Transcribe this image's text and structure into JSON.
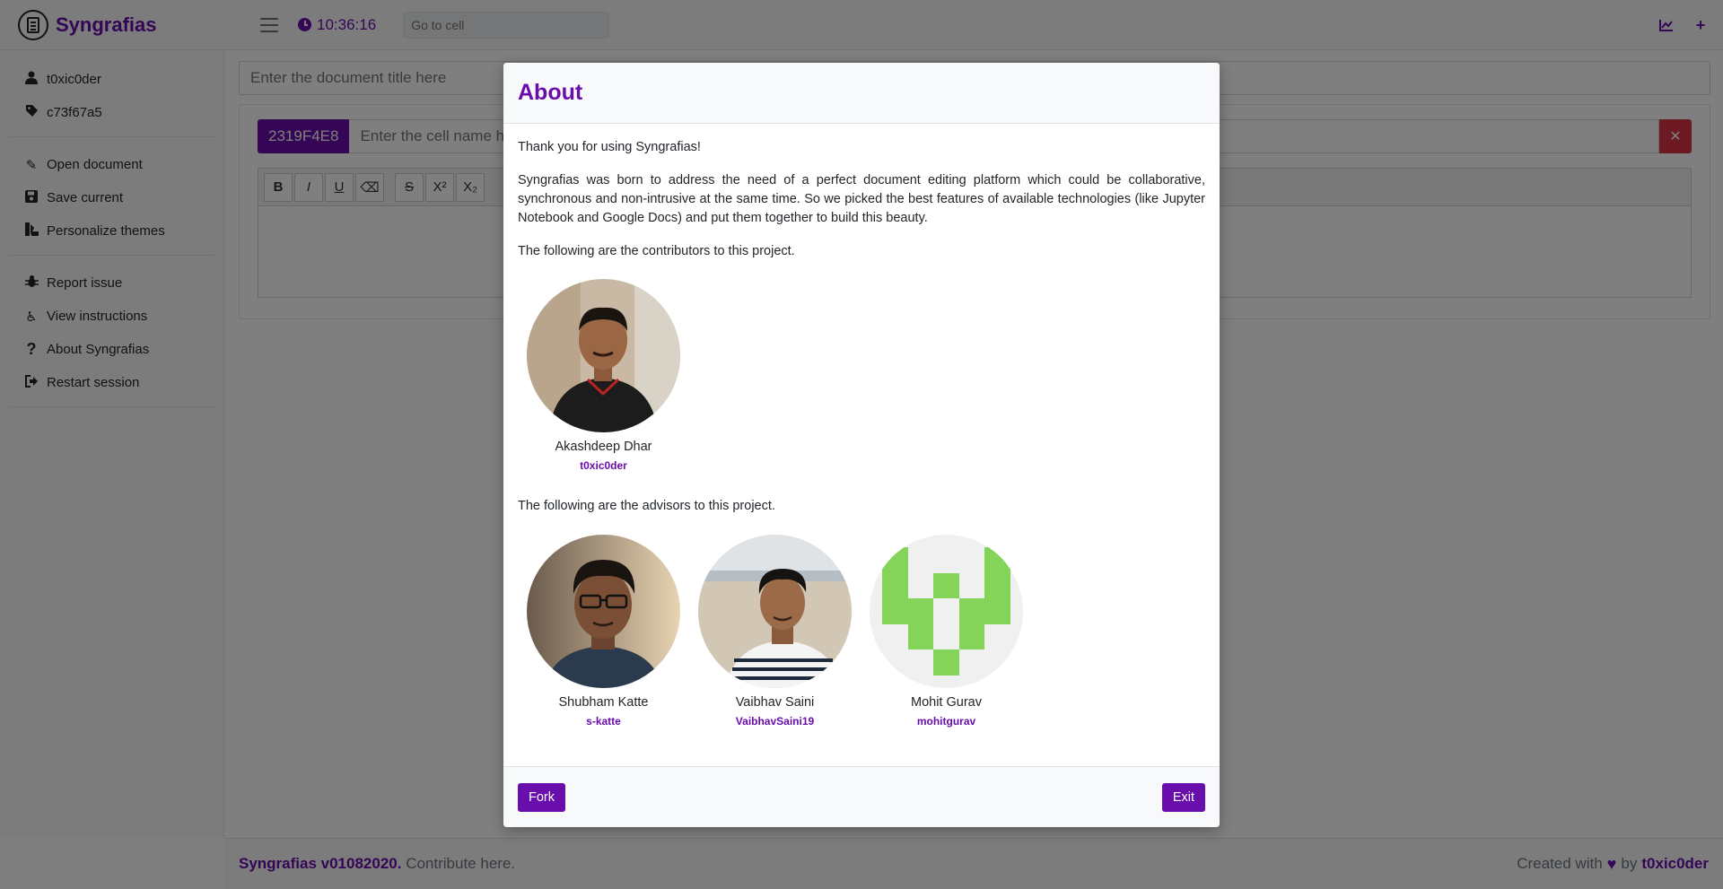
{
  "navbar": {
    "brand": "Syngrafias",
    "clock": "10:36:16",
    "goto_placeholder": "Go to cell",
    "accent": "#6a0dad"
  },
  "sidebar": {
    "user": "t0xic0der",
    "tag": "c73f67a5",
    "items": [
      {
        "label": "Open document",
        "icon": "open-document-icon"
      },
      {
        "label": "Save current",
        "icon": "save-icon"
      },
      {
        "label": "Personalize themes",
        "icon": "themes-icon"
      },
      {
        "label": "Report issue",
        "icon": "bug-icon"
      },
      {
        "label": "View instructions",
        "icon": "instructions-icon"
      },
      {
        "label": "About Syngrafias",
        "icon": "question-icon"
      },
      {
        "label": "Restart session",
        "icon": "sign-out-icon"
      }
    ]
  },
  "main": {
    "title_placeholder": "Enter the document title here",
    "cell": {
      "id": "2319F4E8",
      "name_placeholder": "Enter the cell name here"
    },
    "toolbar": [
      "B",
      "I",
      "U",
      "⌫",
      "S",
      "X²",
      "X₂"
    ]
  },
  "footer": {
    "version": "Syngrafias v01082020.",
    "contribute": "Contribute here.",
    "created_with": "Created with",
    "by": "by",
    "author": "t0xic0der"
  },
  "modal": {
    "title": "About",
    "thanks": "Thank you for using Syngrafias!",
    "description": "Syngrafias was born to address the need of a perfect document editing platform which could be collaborative, synchronous and non-intrusive at the same time. So we picked the best features of available technologies (like Jupyter Notebook and Google Docs) and put them together to build this beauty.",
    "contributors_intro": "The following are the contributors to this project.",
    "contributors": [
      {
        "name": "Akashdeep Dhar",
        "handle": "t0xic0der"
      }
    ],
    "advisors_intro": "The following are the advisors to this project.",
    "advisors": [
      {
        "name": "Shubham Katte",
        "handle": "s-katte"
      },
      {
        "name": "Vaibhav Saini",
        "handle": "VaibhavSaini19"
      },
      {
        "name": "Mohit Gurav",
        "handle": "mohitgurav"
      }
    ],
    "fork_label": "Fork",
    "exit_label": "Exit"
  }
}
